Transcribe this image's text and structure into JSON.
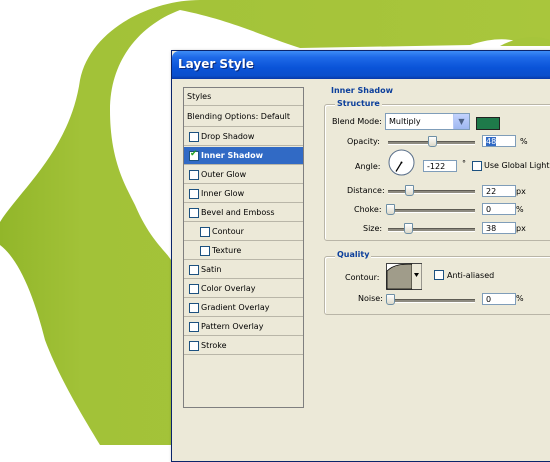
{
  "window": {
    "title": "Layer Style"
  },
  "styles_list": {
    "header": "Styles",
    "blending": "Blending Options: Default",
    "items": [
      {
        "label": "Drop Shadow",
        "checked": false,
        "selected": false,
        "indent": false
      },
      {
        "label": "Inner Shadow",
        "checked": true,
        "selected": true,
        "indent": false
      },
      {
        "label": "Outer Glow",
        "checked": false,
        "selected": false,
        "indent": false
      },
      {
        "label": "Inner Glow",
        "checked": false,
        "selected": false,
        "indent": false
      },
      {
        "label": "Bevel and Emboss",
        "checked": false,
        "selected": false,
        "indent": false
      },
      {
        "label": "Contour",
        "checked": false,
        "selected": false,
        "indent": true
      },
      {
        "label": "Texture",
        "checked": false,
        "selected": false,
        "indent": true
      },
      {
        "label": "Satin",
        "checked": false,
        "selected": false,
        "indent": false
      },
      {
        "label": "Color Overlay",
        "checked": false,
        "selected": false,
        "indent": false
      },
      {
        "label": "Gradient Overlay",
        "checked": false,
        "selected": false,
        "indent": false
      },
      {
        "label": "Pattern Overlay",
        "checked": false,
        "selected": false,
        "indent": false
      },
      {
        "label": "Stroke",
        "checked": false,
        "selected": false,
        "indent": false
      }
    ]
  },
  "inner_shadow": {
    "section_title": "Inner Shadow",
    "structure": {
      "title": "Structure",
      "blend_mode_label": "Blend Mode:",
      "blend_mode_value": "Multiply",
      "shadow_color": "#1e7a4a",
      "opacity_label": "Opacity:",
      "opacity_value": "48",
      "opacity_unit": "%",
      "angle_label": "Angle:",
      "angle_value": "-122",
      "angle_unit": "°",
      "global_light_label": "Use Global Light",
      "global_light_checked": false,
      "distance_label": "Distance:",
      "distance_value": "22",
      "distance_unit": "px",
      "choke_label": "Choke:",
      "choke_value": "0",
      "choke_unit": "%",
      "size_label": "Size:",
      "size_value": "38",
      "size_unit": "px"
    },
    "quality": {
      "title": "Quality",
      "contour_label": "Contour:",
      "anti_aliased_label": "Anti-aliased",
      "anti_aliased_checked": false,
      "noise_label": "Noise:",
      "noise_value": "0",
      "noise_unit": "%"
    }
  }
}
